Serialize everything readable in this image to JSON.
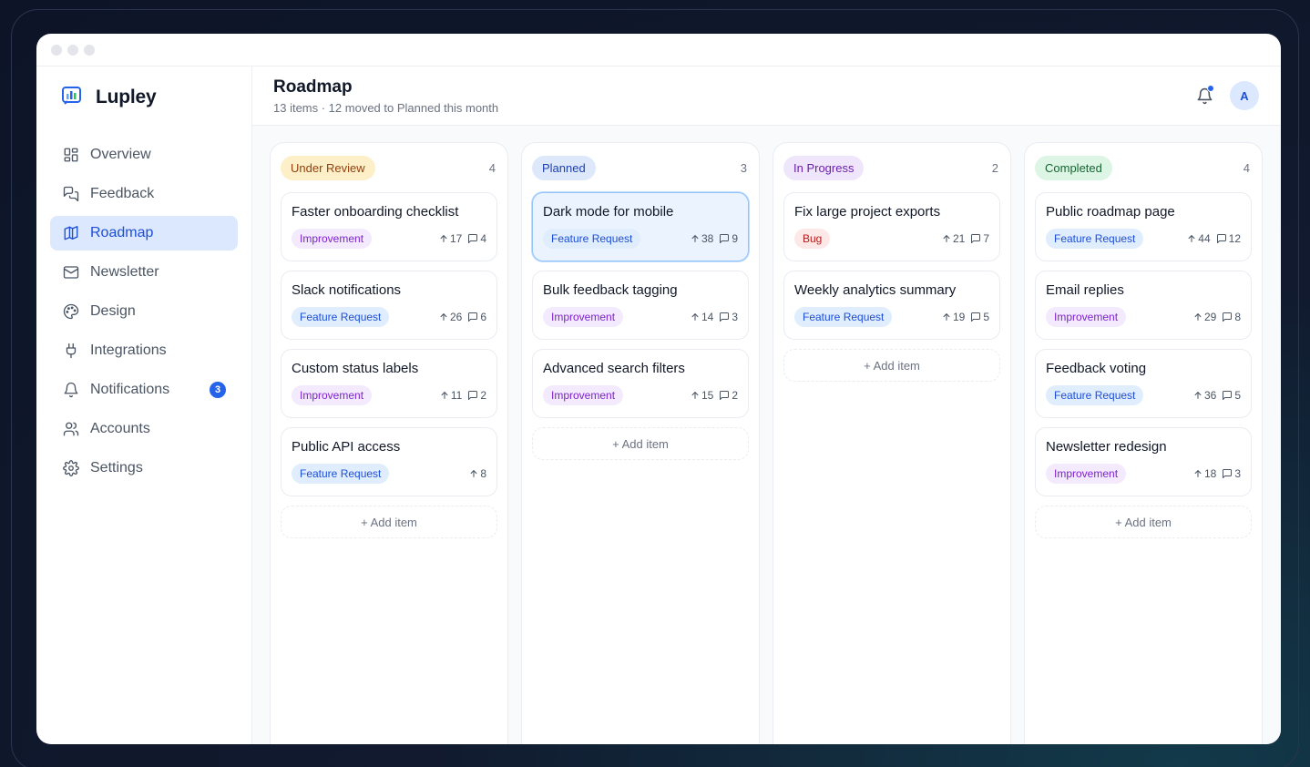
{
  "app": {
    "name": "Lupley"
  },
  "sidebar": {
    "items": [
      {
        "label": "Overview",
        "icon": "grid-icon",
        "active": false
      },
      {
        "label": "Feedback",
        "icon": "chat-icon",
        "active": false
      },
      {
        "label": "Roadmap",
        "icon": "map-icon",
        "active": true
      },
      {
        "label": "Newsletter",
        "icon": "mail-icon",
        "active": false
      },
      {
        "label": "Design",
        "icon": "palette-icon",
        "active": false
      },
      {
        "label": "Integrations",
        "icon": "plug-icon",
        "active": false
      },
      {
        "label": "Notifications",
        "icon": "bell-icon",
        "active": false,
        "badge": "3"
      },
      {
        "label": "Accounts",
        "icon": "users-icon",
        "active": false
      },
      {
        "label": "Settings",
        "icon": "gear-icon",
        "active": false
      }
    ]
  },
  "header": {
    "title": "Roadmap",
    "subtitle": "13 items · 12 moved to Planned this month",
    "avatar_initial": "A"
  },
  "colors": {
    "accent": "#2563eb"
  },
  "board": {
    "add_item_label": "+ Add item",
    "columns": [
      {
        "status": "Under Review",
        "count": "4",
        "pill_bg": "#fdf0c8",
        "pill_fg": "#92400e",
        "cards": [
          {
            "title": "Faster onboarding checklist",
            "tag": "Improvement",
            "tag_type": "improvement",
            "votes": "17",
            "comments": "4"
          },
          {
            "title": "Slack notifications",
            "tag": "Feature Request",
            "tag_type": "feature",
            "votes": "26",
            "comments": "6"
          },
          {
            "title": "Custom status labels",
            "tag": "Improvement",
            "tag_type": "improvement",
            "votes": "11",
            "comments": "2"
          },
          {
            "title": "Public API access",
            "tag": "Feature Request",
            "tag_type": "feature",
            "votes": "8",
            "comments": null
          }
        ]
      },
      {
        "status": "Planned",
        "count": "3",
        "pill_bg": "#dde9fb",
        "pill_fg": "#1e40af",
        "cards": [
          {
            "title": "Dark mode for mobile",
            "tag": "Feature Request",
            "tag_type": "feature",
            "votes": "38",
            "comments": "9",
            "highlight": true
          },
          {
            "title": "Bulk feedback tagging",
            "tag": "Improvement",
            "tag_type": "improvement",
            "votes": "14",
            "comments": "3"
          },
          {
            "title": "Advanced search filters",
            "tag": "Improvement",
            "tag_type": "improvement",
            "votes": "15",
            "comments": "2"
          }
        ]
      },
      {
        "status": "In Progress",
        "count": "2",
        "pill_bg": "#efe6fc",
        "pill_fg": "#6b21a8",
        "cards": [
          {
            "title": "Fix large project exports",
            "tag": "Bug",
            "tag_type": "bug",
            "votes": "21",
            "comments": "7"
          },
          {
            "title": "Weekly analytics summary",
            "tag": "Feature Request",
            "tag_type": "feature",
            "votes": "19",
            "comments": "5"
          }
        ]
      },
      {
        "status": "Completed",
        "count": "4",
        "pill_bg": "#dcf5e4",
        "pill_fg": "#166534",
        "cards": [
          {
            "title": "Public roadmap page",
            "tag": "Feature Request",
            "tag_type": "feature",
            "votes": "44",
            "comments": "12"
          },
          {
            "title": "Email replies",
            "tag": "Improvement",
            "tag_type": "improvement",
            "votes": "29",
            "comments": "8"
          },
          {
            "title": "Feedback voting",
            "tag": "Feature Request",
            "tag_type": "feature",
            "votes": "36",
            "comments": "5"
          },
          {
            "title": "Newsletter redesign",
            "tag": "Improvement",
            "tag_type": "improvement",
            "votes": "18",
            "comments": "3"
          }
        ]
      }
    ]
  }
}
